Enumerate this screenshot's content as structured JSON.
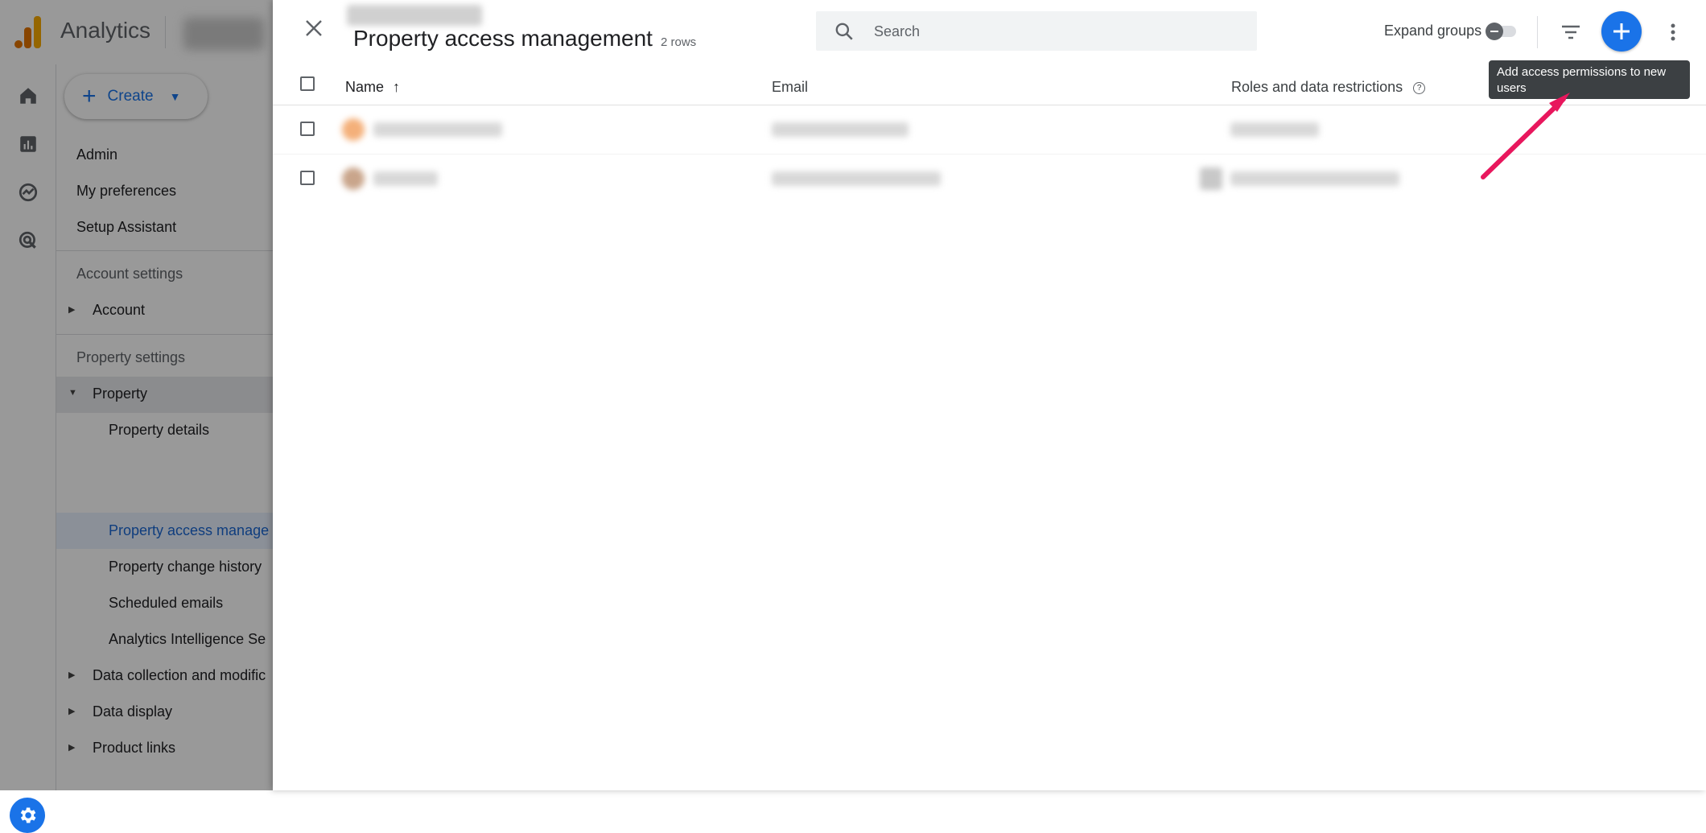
{
  "app": {
    "name": "Analytics"
  },
  "sidebar": {
    "create_label": "Create",
    "items": {
      "admin": "Admin",
      "my_preferences": "My preferences",
      "setup_assistant": "Setup Assistant",
      "account_settings": "Account settings",
      "account": "Account",
      "property_settings": "Property settings",
      "property": "Property",
      "property_details": "Property details",
      "property_access": "Property access manage",
      "property_change_history": "Property change history",
      "scheduled_emails": "Scheduled emails",
      "analytics_intelligence": "Analytics Intelligence Se",
      "data_collection": "Data collection and modific",
      "data_display": "Data display",
      "product_links": "Product links"
    }
  },
  "panel": {
    "title": "Property access management",
    "row_count": "2 rows",
    "search_placeholder": "Search",
    "expand_groups_label": "Expand groups",
    "tooltip": "Add access permissions to new users",
    "columns": {
      "name": "Name",
      "email": "Email",
      "roles": "Roles and data restrictions"
    }
  },
  "colors": {
    "accent": "#1a73e8",
    "annotation_arrow": "#e8175d"
  }
}
